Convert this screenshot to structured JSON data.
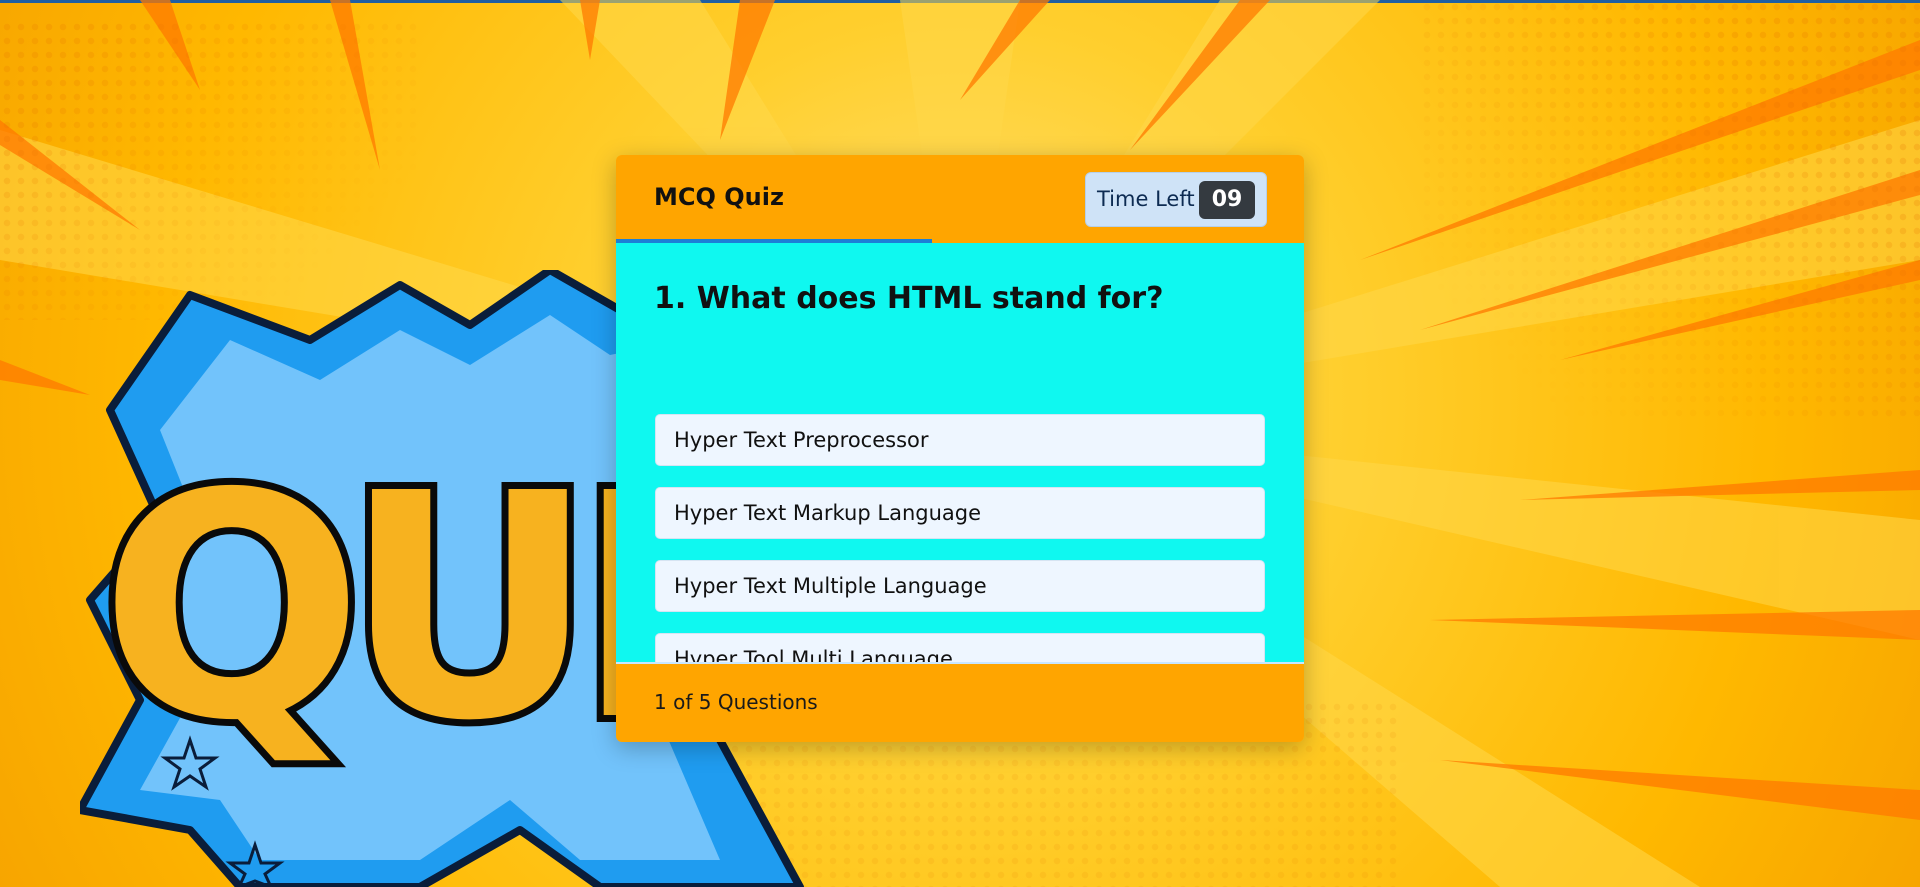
{
  "quiz": {
    "title": "MCQ Quiz",
    "timer_label": "Time Left",
    "timer_value": "09",
    "progress_fraction": 0.46
  },
  "question": {
    "text": "1. What does HTML stand for?",
    "options": [
      "Hyper Text Preprocessor",
      "Hyper Text Markup Language",
      "Hyper Text Multiple Language",
      "Hyper Tool Multi Language"
    ]
  },
  "footer": {
    "current": "1",
    "of": "of",
    "total": "5",
    "suffix": "Questions"
  },
  "background": {
    "logo_text": "QUI"
  },
  "colors": {
    "header": "#ffa500",
    "body": "#0ff8f0",
    "timer_bg": "#cfe3f7",
    "timer_badge": "#343a40",
    "progress": "#1c7fd6",
    "background": "#ffc21a"
  }
}
